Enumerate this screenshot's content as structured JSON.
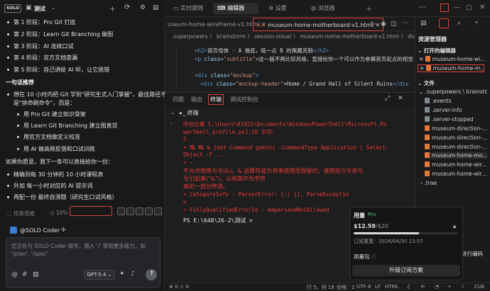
{
  "chat": {
    "logo": "SOLO",
    "title": "测试",
    "top_items": [
      "第 1 阶段：Pro Git 打底",
      "第 2 阶段：Learn Git Branching 做图",
      "第 3 阶段：AI 连续口试",
      "第 4 阶段：官方文档查漏",
      "第 5 阶段：自己讲给 AI 听，让它挑错"
    ],
    "section_title": "一句话推荐",
    "recommend_intro_1": "想在 10 小时内把 Git 学到\"研究生式入门掌握\"，最佳路径不",
    "recommend_intro_2": "是\"拼命刷命令\"，而是：",
    "recommend_sub": [
      "用 Pro Git 建立知识骨架",
      "用 Learn Git Branching 建立图直觉",
      "用官方文档做定义校准",
      "用 AI 做高频反馈和口试训练"
    ],
    "followup": "如果你愿意，我下一条可以直接给你一份：",
    "followup_items": [
      "精确到每 30 分钟的 10 小时课程表",
      "外加 每一小时对应的 AI 提示词",
      "再配一份 最终自测题（研究生口试风格）"
    ],
    "task_status": "任务完成",
    "task_percent": "10%",
    "coder_name": "@SOLO Coder",
    "input_placeholder": "您正在与 SOLO Coder 聊天，输入 '/' 获取更多能力，如 '/plan', '/spec'",
    "model": "GPT-5.4"
  },
  "nav": {
    "tabs": [
      "实时跟随",
      "编辑器",
      "设置",
      "浏览器"
    ]
  },
  "editor": {
    "tabs": [
      "useum-home-wireframe-v1.html",
      "museum-home-motherboard-v1.html"
    ],
    "breadcrumb": ".superpowers 〉 brainstorm 〉 session-visual 〉 museum-home-motherboard-v1.html 〉 div.moc",
    "code": {
      "line1_open": "<h2>",
      "line1_text": "首页母体 · A 做底，吸一点 B 的策藏克制",
      "line1_close": "</h2>",
      "line2_open": "<p",
      "line2_attr": " class=",
      "line2_val": "\"subtitle\"",
      "line2_text": ">这一版不再比较风格，直接给你一个可以作为参赛首页起点的视觉",
      "line3_open": "<div",
      "line3_attr": " class=",
      "line3_val": "\"mockup\"",
      "line3_close": ">",
      "line4_open": "<div",
      "line4_attr": " class=",
      "line4_val": "\"mockup-header\"",
      "line4_text": ">Home / Grand Hall of Silent Ruins",
      "line4_close": "</div"
    }
  },
  "terminal": {
    "tabs": [
      "问题",
      "输出",
      "终端",
      "调试控制台"
    ],
    "header": "终端",
    "lines": [
      "所在位置 C:\\Users\\81921\\Documents\\WindowsPowerShell\\Microsoft.Po",
      "werShell_profile.ps1:20 字符：",
      "5",
      "+ 略  略 & {Get-Command gemini -CommandType Application | Select-",
      "Object -F ...",
      "+       ~",
      "不允许使用与号(&)。& 运算符是为将来使用而保留的；请用双引号将与",
      "号引起来(\"&\")，以将其作为字符",
      "串的一部分传递。",
      "    + CategoryInfo          : ParserError: (:) [], ParseExceptio",
      "n",
      "    + FullyQualifiedErrorId : AmpersandNotAllowed"
    ],
    "prompt": "PS E:\\648\\26-2\\测试 >"
  },
  "explorer": {
    "title": "资源管理器",
    "open_editors_label": "打开的编辑器",
    "open_editors": [
      "museum-home-wi...",
      "museum-home-m..."
    ],
    "files_label": "文件",
    "root": ".superpowers \\ brainstorm...",
    "files": [
      ".events",
      ".server-info",
      ".server-stopped",
      "museum-direction-...",
      "museum-direction-...",
      "museum-direction-...",
      "museum-home-mo...",
      "museum-home-wir...",
      "museum-home-wir..."
    ],
    "trae": ".trae",
    "partial_text": "进行编码"
  },
  "usage": {
    "title": "用量",
    "plan": "Pro",
    "amount": "$12.59",
    "limit": "/$20",
    "expire": "订阅重置：2026/04/30 13:57",
    "pack_label": "用量包",
    "upgrade": "升级订阅方案",
    "progress": 0.63
  },
  "status": {
    "errors": "0",
    "warnings": "0",
    "position": "行 5，列 18",
    "spaces": "空格：2",
    "encoding": "UTF-8",
    "eol": "LF",
    "lang": "HTML",
    "locale": "CUE"
  }
}
